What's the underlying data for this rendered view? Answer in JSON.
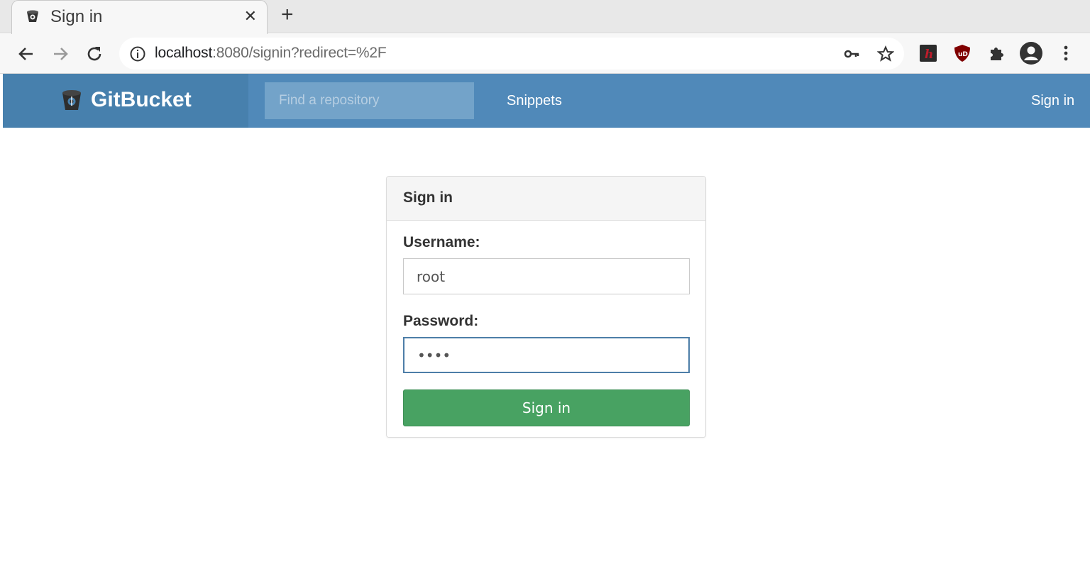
{
  "browser": {
    "tab_title": "Sign in",
    "tab_close": "✕",
    "new_tab": "+",
    "url_host": "localhost",
    "url_path": ":8080/signin?redirect=%2F"
  },
  "app": {
    "brand": "GitBucket",
    "search_placeholder": "Find a repository",
    "snippets_label": "Snippets",
    "signin_link": "Sign in",
    "colors": {
      "navbar": "#5089b9",
      "brand_bg": "#4780ad",
      "button": "#48a262"
    }
  },
  "form": {
    "heading": "Sign in",
    "username_label": "Username:",
    "username_value": "root",
    "password_label": "Password:",
    "password_value": "root",
    "submit_label": "Sign in"
  }
}
